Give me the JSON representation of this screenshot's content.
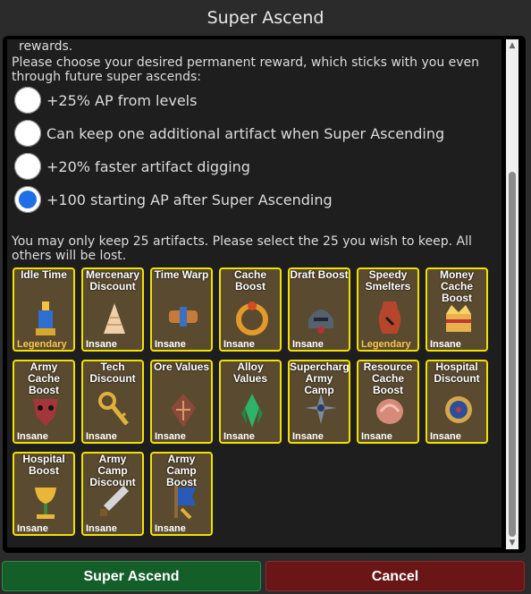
{
  "window": {
    "title": "Super Ascend"
  },
  "intro": {
    "cut_line": "rewards.",
    "prompt": "Please choose your desired permanent reward, which sticks with you even through future super ascends:"
  },
  "rewards": [
    {
      "label": "+25% AP from levels",
      "selected": false
    },
    {
      "label": "Can keep one additional artifact when Super Ascending",
      "selected": false
    },
    {
      "label": "+20% faster artifact digging",
      "selected": false
    },
    {
      "label": "+100 starting AP after Super Ascending",
      "selected": true
    }
  ],
  "artifact_note": "You may only keep 25 artifacts.  Please select the 25 you wish to keep.  All others will be lost.",
  "artifacts": [
    {
      "name": "Idle Time",
      "rarity": "Legendary",
      "icon": "candle-icon"
    },
    {
      "name": "Mercenary Discount",
      "rarity": "Insane",
      "icon": "shell-icon"
    },
    {
      "name": "Time Warp",
      "rarity": "Insane",
      "icon": "bundle-icon"
    },
    {
      "name": "Cache Boost",
      "rarity": "Insane",
      "icon": "ring-icon"
    },
    {
      "name": "Draft Boost",
      "rarity": "Insane",
      "icon": "helmet-icon"
    },
    {
      "name": "Speedy Smelters",
      "rarity": "Legendary",
      "icon": "vase-icon"
    },
    {
      "name": "Money Cache Boost",
      "rarity": "Insane",
      "icon": "crown-icon"
    },
    {
      "name": "Army Cache Boost",
      "rarity": "Insane",
      "icon": "mask-icon"
    },
    {
      "name": "Tech Discount",
      "rarity": "Insane",
      "icon": "key-icon"
    },
    {
      "name": "Ore Values",
      "rarity": "Insane",
      "icon": "shield-icon"
    },
    {
      "name": "Alloy Values",
      "rarity": "Insane",
      "icon": "crystal-icon"
    },
    {
      "name": "Supercharge Army Camp",
      "rarity": "Insane",
      "icon": "shuriken-icon"
    },
    {
      "name": "Resource Cache Boost",
      "rarity": "Insane",
      "icon": "conch-icon"
    },
    {
      "name": "Hospital Discount",
      "rarity": "Insane",
      "icon": "compass-icon"
    },
    {
      "name": "Hospital Boost",
      "rarity": "Insane",
      "icon": "goblet-icon"
    },
    {
      "name": "Army Camp Discount",
      "rarity": "Insane",
      "icon": "sword-icon"
    },
    {
      "name": "Army Camp Boost",
      "rarity": "Insane",
      "icon": "banner-icon"
    }
  ],
  "buttons": {
    "ascend": "Super Ascend",
    "cancel": "Cancel"
  },
  "colors": {
    "card_border": "#f2e100",
    "legendary": "#f6c64a",
    "selected_radio": "#1e6fe6"
  }
}
